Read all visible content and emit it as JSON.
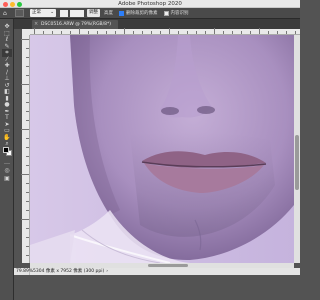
{
  "app": {
    "title": "Adobe Photoshop 2020"
  },
  "options_bar": {
    "home_icon": "home-icon",
    "tool_icon": "marquee-tool-icon",
    "style_label": "正常",
    "style_arrow": "⌄",
    "select_subject_label": "调整",
    "width_label": "高度",
    "select_mask_label": "删除裁剪的像素",
    "content_aware_label": "内容识别"
  },
  "document": {
    "tab_title": "DSC0516.ARW @ 79%(RGB/8*)",
    "close_glyph": "×"
  },
  "tools": [
    {
      "name": "move-tool-icon",
      "glyph": "✥"
    },
    {
      "name": "marquee-tool-icon",
      "glyph": "⬚"
    },
    {
      "name": "lasso-tool-icon",
      "glyph": "ℓ"
    },
    {
      "name": "quick-select-tool-icon",
      "glyph": "✎"
    },
    {
      "name": "crop-tool-icon",
      "glyph": "⌗"
    },
    {
      "name": "eyedropper-tool-icon",
      "glyph": "⁄"
    },
    {
      "name": "healing-brush-tool-icon",
      "glyph": "✚"
    },
    {
      "name": "brush-tool-icon",
      "glyph": "∕"
    },
    {
      "name": "clone-stamp-tool-icon",
      "glyph": "⊥"
    },
    {
      "name": "history-brush-tool-icon",
      "glyph": "↺"
    },
    {
      "name": "eraser-tool-icon",
      "glyph": "◧"
    },
    {
      "name": "gradient-tool-icon",
      "glyph": "▮"
    },
    {
      "name": "dodge-tool-icon",
      "glyph": "●"
    },
    {
      "name": "pen-tool-icon",
      "glyph": "✒"
    },
    {
      "name": "type-tool-icon",
      "glyph": "T"
    },
    {
      "name": "path-select-tool-icon",
      "glyph": "➤"
    },
    {
      "name": "shape-tool-icon",
      "glyph": "▭"
    },
    {
      "name": "hand-tool-icon",
      "glyph": "✋"
    },
    {
      "name": "zoom-tool-icon",
      "glyph": "⌕"
    }
  ],
  "extra_tools": [
    {
      "name": "more-tools-icon",
      "glyph": "…"
    },
    {
      "name": "quick-mask-icon",
      "glyph": "◎"
    },
    {
      "name": "screen-mode-icon",
      "glyph": "▣"
    }
  ],
  "status": {
    "zoom": "79.89%",
    "info": "5304 像素 x 7952 像素 (300 ppi)",
    "arrow": "›"
  },
  "colors": {
    "ui_dark": "#535353",
    "canvas_bg": "#cbbbe0",
    "skin_lavender": "#b39ac9",
    "lips": "#a07297",
    "foreground": "#000000",
    "background": "#ffffff"
  }
}
